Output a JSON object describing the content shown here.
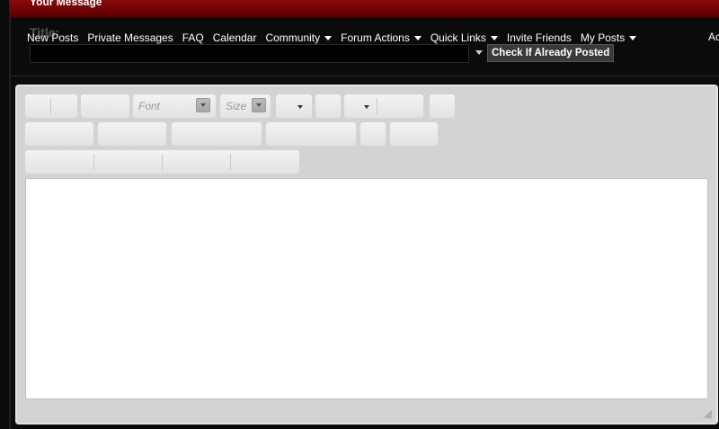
{
  "header": {
    "title": "Your Message"
  },
  "form": {
    "title_label": "Title:",
    "check_button": "Check If Already Posted"
  },
  "navbar": {
    "items": [
      {
        "label": "New Posts",
        "dropdown": false
      },
      {
        "label": "Private Messages",
        "dropdown": false
      },
      {
        "label": "FAQ",
        "dropdown": false
      },
      {
        "label": "Calendar",
        "dropdown": false
      },
      {
        "label": "Community",
        "dropdown": true
      },
      {
        "label": "Forum Actions",
        "dropdown": true
      },
      {
        "label": "Quick Links",
        "dropdown": true
      },
      {
        "label": "Invite Friends",
        "dropdown": false
      },
      {
        "label": "My Posts",
        "dropdown": true
      }
    ],
    "overflow_label": "Ac"
  },
  "editor": {
    "font_select": "Font",
    "size_select": "Size"
  },
  "colors": {
    "header_red": "#8a0a0a",
    "background": "#0b0b0b",
    "editor_gray": "#d3d3d3"
  }
}
